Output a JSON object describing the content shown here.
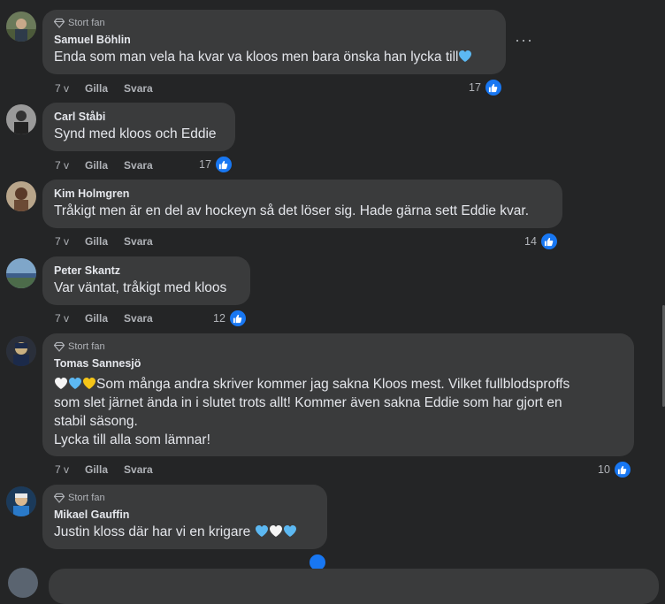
{
  "badge_label": "Stort fan",
  "actions": {
    "like": "Gilla",
    "reply": "Svara"
  },
  "comments": [
    {
      "author": "Samuel Böhlin",
      "has_badge": true,
      "text": "Enda som man vela ha kvar va kloos men bara önska han lycka till",
      "time": "7 v",
      "likes": "17",
      "trailing_hearts": [
        "blue"
      ]
    },
    {
      "author": "Carl Ståbi",
      "has_badge": false,
      "text": "Synd med kloos och Eddie",
      "time": "7 v",
      "likes": "17"
    },
    {
      "author": "Kim Holmgren",
      "has_badge": false,
      "text": "Tråkigt men är en del av hockeyn så det löser sig. Hade gärna sett Eddie kvar.",
      "time": "7 v",
      "likes": "14"
    },
    {
      "author": "Peter Skantz",
      "has_badge": false,
      "text": "Var väntat, tråkigt med kloos",
      "time": "7 v",
      "likes": "12"
    },
    {
      "author": "Tomas Sannesjö",
      "has_badge": true,
      "leading_hearts": [
        "white",
        "blue",
        "yellow"
      ],
      "text_lines": [
        "Som många andra skriver kommer jag sakna Kloos mest. Vilket fullblodsproffs",
        "som slet järnet ända in i slutet trots allt! Kommer även sakna Eddie som har gjort en",
        "stabil säsong.",
        "Lycka till alla som lämnar!"
      ],
      "time": "7 v",
      "likes": "10"
    },
    {
      "author": "Mikael Gauffin",
      "has_badge": true,
      "text": "Justin kloss där har vi en krigare ",
      "trailing_hearts": [
        "blue",
        "white",
        "blue"
      ]
    }
  ],
  "colors": {
    "background": "#242526",
    "bubble": "#3a3b3c",
    "like_blue": "#1877f2",
    "muted": "#b0b3b8",
    "text": "#e4e6eb"
  },
  "icons": {
    "badge": "diamond-icon",
    "like": "thumbs-up-icon",
    "more": "more-options-icon"
  },
  "more_label": "···"
}
